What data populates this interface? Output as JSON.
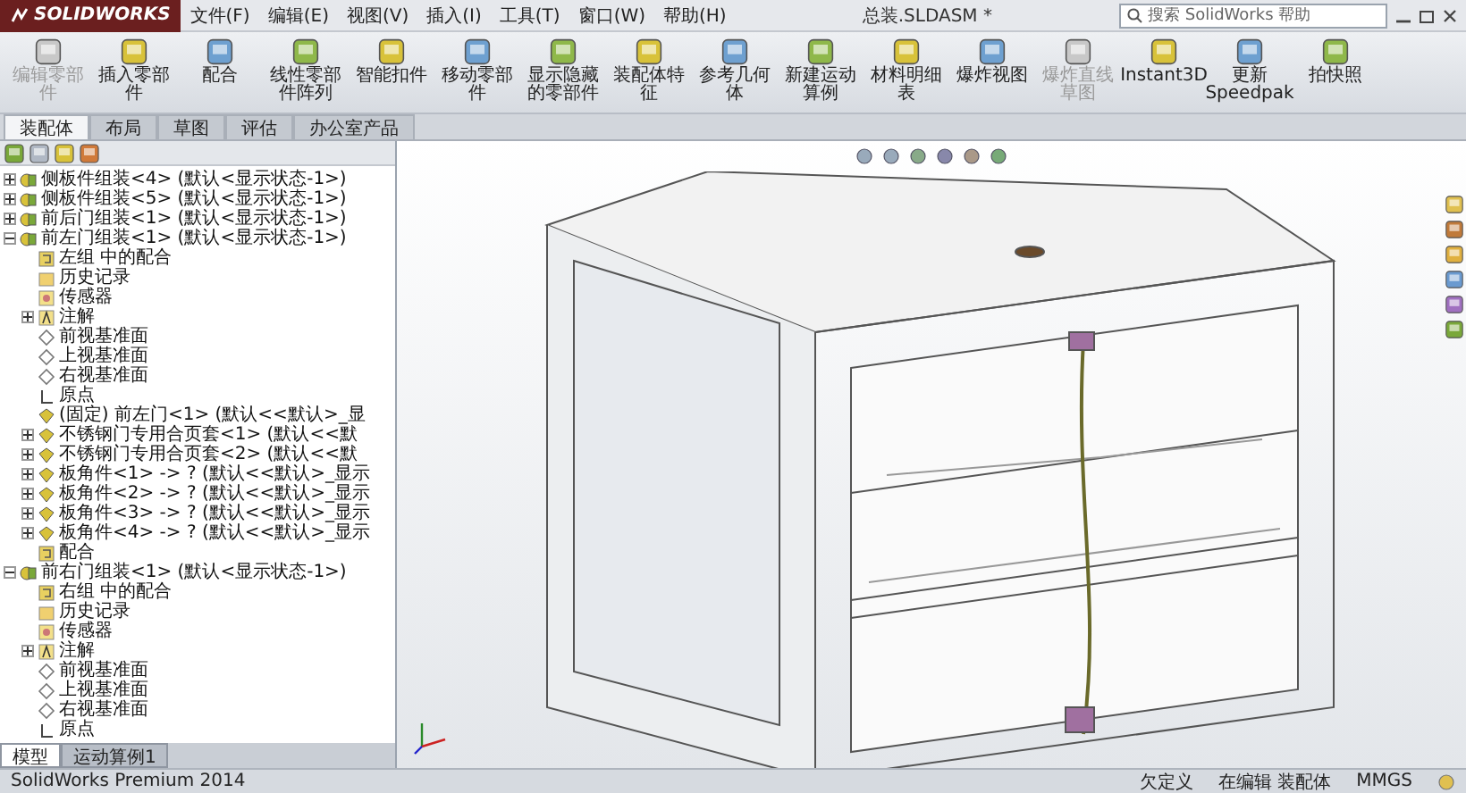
{
  "app": {
    "logo": "SOLIDWORKS",
    "menu": [
      "文件(F)",
      "编辑(E)",
      "视图(V)",
      "插入(I)",
      "工具(T)",
      "窗口(W)",
      "帮助(H)"
    ],
    "title": "总装.SLDASM *",
    "search": {
      "placeholder": "搜索 SolidWorks 帮助"
    }
  },
  "toolbar": [
    {
      "label": "编辑零部件",
      "disabled": true
    },
    {
      "label": "插入零部件",
      "disabled": false
    },
    {
      "label": "配合",
      "disabled": false
    },
    {
      "label": "线性零部件阵列",
      "disabled": false
    },
    {
      "label": "智能扣件",
      "disabled": false
    },
    {
      "label": "移动零部件",
      "disabled": false
    },
    {
      "label": "显示隐藏的零部件",
      "disabled": false
    },
    {
      "label": "装配体特征",
      "disabled": false
    },
    {
      "label": "参考几何体",
      "disabled": false
    },
    {
      "label": "新建运动算例",
      "disabled": false
    },
    {
      "label": "材料明细表",
      "disabled": false
    },
    {
      "label": "爆炸视图",
      "disabled": false
    },
    {
      "label": "爆炸直线草图",
      "disabled": true
    },
    {
      "label": "Instant3D",
      "disabled": false
    },
    {
      "label": "更新Speedpak",
      "disabled": false
    },
    {
      "label": "拍快照",
      "disabled": false
    }
  ],
  "command_tabs": [
    {
      "label": "装配体",
      "selected": true
    },
    {
      "label": "布局",
      "selected": false
    },
    {
      "label": "草图",
      "selected": false
    },
    {
      "label": "评估",
      "selected": false
    },
    {
      "label": "办公室产品",
      "selected": false
    }
  ],
  "tree": [
    {
      "kind": "assembly",
      "label": "侧板件组装<4> (默认<显示状态-1>)",
      "expanded": false
    },
    {
      "kind": "assembly",
      "label": "侧板件组装<5> (默认<显示状态-1>)",
      "expanded": false
    },
    {
      "kind": "assembly",
      "label": "前后门组装<1> (默认<显示状态-1>)",
      "expanded": false
    },
    {
      "kind": "assembly",
      "label": "前左门组装<1> (默认<显示状态-1>)",
      "expanded": true,
      "children": [
        {
          "kind": "mates",
          "label": "左组 中的配合"
        },
        {
          "kind": "history",
          "label": "历史记录"
        },
        {
          "kind": "sensor",
          "label": "传感器"
        },
        {
          "kind": "annotation",
          "label": "注解",
          "expanded": false
        },
        {
          "kind": "plane",
          "label": "前视基准面"
        },
        {
          "kind": "plane",
          "label": "上视基准面"
        },
        {
          "kind": "plane",
          "label": "右视基准面"
        },
        {
          "kind": "origin",
          "label": "原点"
        },
        {
          "kind": "part",
          "label": "(固定) 前左门<1> (默认<<默认>_显"
        },
        {
          "kind": "part",
          "label": "不锈钢门专用合页套<1> (默认<<默",
          "expanded": false
        },
        {
          "kind": "part",
          "label": "不锈钢门专用合页套<2> (默认<<默",
          "expanded": false
        },
        {
          "kind": "part",
          "label": "板角件<1> -> ? (默认<<默认>_显示",
          "expanded": false
        },
        {
          "kind": "part",
          "label": "板角件<2> -> ? (默认<<默认>_显示",
          "expanded": false
        },
        {
          "kind": "part",
          "label": "板角件<3> -> ? (默认<<默认>_显示",
          "expanded": false
        },
        {
          "kind": "part",
          "label": "板角件<4> -> ? (默认<<默认>_显示",
          "expanded": false
        },
        {
          "kind": "mates",
          "label": "配合"
        }
      ]
    },
    {
      "kind": "assembly",
      "label": "前右门组装<1> (默认<显示状态-1>)",
      "expanded": true,
      "children": [
        {
          "kind": "mates",
          "label": "右组 中的配合"
        },
        {
          "kind": "history",
          "label": "历史记录"
        },
        {
          "kind": "sensor",
          "label": "传感器"
        },
        {
          "kind": "annotation",
          "label": "注解",
          "expanded": false
        },
        {
          "kind": "plane",
          "label": "前视基准面"
        },
        {
          "kind": "plane",
          "label": "上视基准面"
        },
        {
          "kind": "plane",
          "label": "右视基准面"
        },
        {
          "kind": "origin",
          "label": "原点"
        }
      ]
    }
  ],
  "panel_tabs": [
    {
      "label": "模型",
      "selected": true
    },
    {
      "label": "运动算例1",
      "selected": false
    }
  ],
  "status_bar": {
    "product": "SolidWorks Premium 2014",
    "state": "欠定义",
    "mode": "在编辑 装配体",
    "units": "MMGS"
  }
}
